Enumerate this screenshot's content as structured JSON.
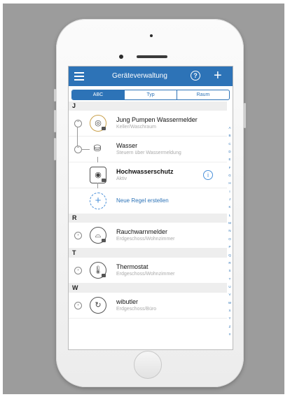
{
  "header": {
    "title": "Geräteverwaltung",
    "help_glyph": "?",
    "add_glyph": "+"
  },
  "tabs": [
    {
      "label": "ABC",
      "active": true
    },
    {
      "label": "Typ",
      "active": false
    },
    {
      "label": "Raum",
      "active": false
    }
  ],
  "sections": {
    "j": {
      "letter": "J",
      "rows": [
        {
          "name": "Jung Pumpen Wassermelder",
          "sub": "Keller/Waschraum",
          "icon": "water-detector-icon"
        },
        {
          "name": "Wasser",
          "sub": "Steuern über Wassermeldung",
          "icon": "water-valve-icon"
        },
        {
          "name": "Hochwasserschutz",
          "sub": "Aktiv",
          "icon": "flood-protection-icon"
        }
      ],
      "new_rule": "Neue Regel erstellen"
    },
    "r": {
      "letter": "R",
      "rows": [
        {
          "name": "Rauchwarnmelder",
          "sub": "Erdgeschoss/Wohnzimmer",
          "icon": "smoke-detector-icon"
        }
      ]
    },
    "t": {
      "letter": "T",
      "rows": [
        {
          "name": "Thermostat",
          "sub": "Erdgeschoss/Wohnzimmer",
          "icon": "thermostat-icon"
        }
      ]
    },
    "w": {
      "letter": "W",
      "rows": [
        {
          "name": "wibutler",
          "sub": "Erdgeschoss/Büro",
          "icon": "wibutler-icon"
        }
      ]
    }
  },
  "index_letters": [
    "A",
    "B",
    "C",
    "D",
    "E",
    "F",
    "G",
    "H",
    "I",
    "J",
    "K",
    "L",
    "M",
    "N",
    "O",
    "P",
    "Q",
    "R",
    "S",
    "T",
    "U",
    "V",
    "W",
    "X",
    "Y",
    "Z",
    "#"
  ],
  "colors": {
    "accent": "#2d73b7",
    "background": "#9c9c9c"
  }
}
